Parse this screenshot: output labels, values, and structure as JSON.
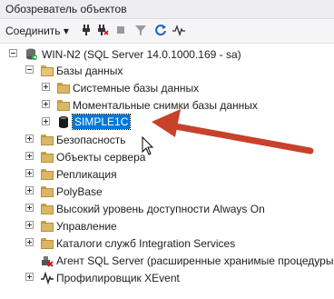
{
  "window": {
    "title": "Обозреватель объектов"
  },
  "toolbar": {
    "connect_label": "Соединить ▾",
    "icons": [
      "connect-icon",
      "disconnect-icon",
      "stop-icon",
      "filter-icon",
      "refresh-icon",
      "activity-monitor-icon"
    ]
  },
  "tree": {
    "server": "WIN-N2 (SQL Server 14.0.1000.169 - sa)",
    "databases": "Базы данных",
    "system_databases": "Системные базы данных",
    "snapshots": "Моментальные снимки базы данных",
    "selected_db": "SIMPLE1C",
    "security": "Безопасность",
    "server_objects": "Объекты сервера",
    "replication": "Репликация",
    "polybase": "PolyBase",
    "always_on": "Высокий уровень доступности Always On",
    "management": "Управление",
    "integration_services": "Каталоги служб Integration Services",
    "sql_agent": "Агент SQL Server (расширенные хранимые процедуры а",
    "xevent_profiler": "Профилировщик XEvent"
  },
  "colors": {
    "selection": "#0078d7",
    "arrow": "#c8412b",
    "folder": "#dcb667"
  }
}
